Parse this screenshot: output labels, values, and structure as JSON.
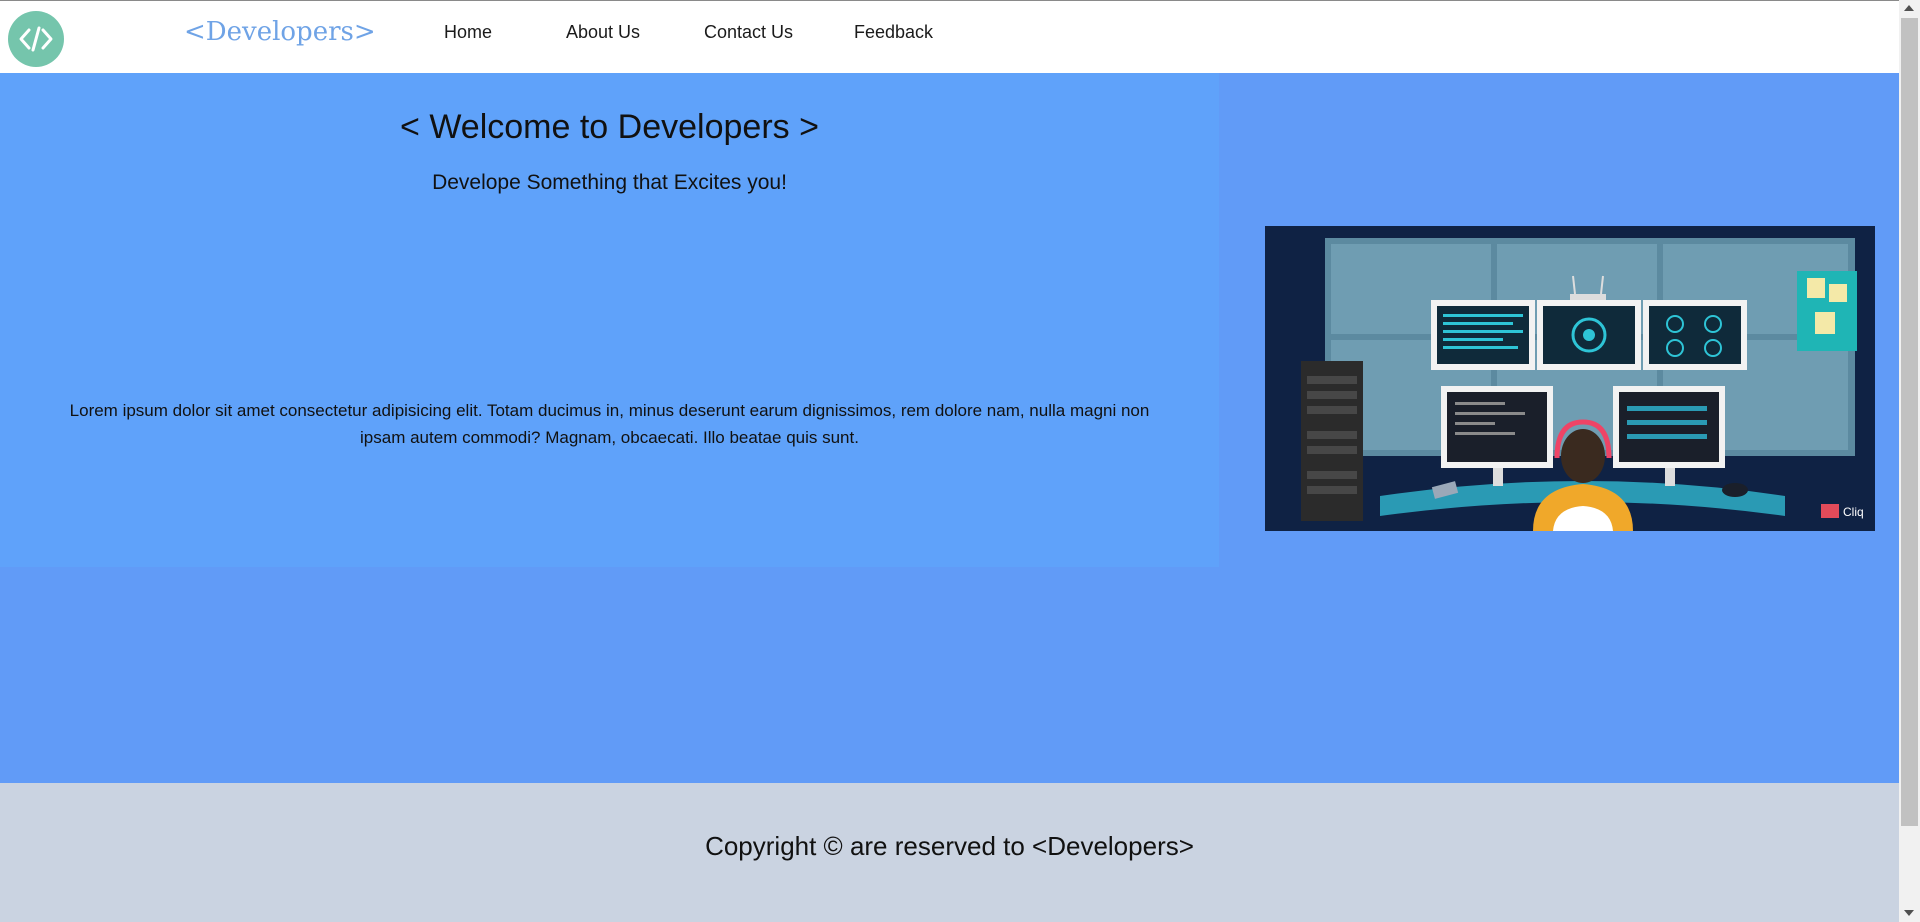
{
  "navbar": {
    "logo_icon": "code-brackets-icon",
    "brand": "<Developers>",
    "links": [
      "Home",
      "About Us",
      "Contact Us",
      "Feedback"
    ]
  },
  "hero": {
    "title": "< Welcome to Developers >",
    "subtitle": "Develope Something that Excites you!",
    "body": "Lorem ipsum dolor sit amet consectetur adipisicing elit. Totam ducimus in, minus deserunt earum dignissimos, rem dolore nam, nulla magni non ipsam autem commodi? Magnam, obcaecati. Illo beatae quis sunt.",
    "illustration_watermark": "Cliq"
  },
  "footer": {
    "text": "Copyright © are reserved to <Developers>"
  },
  "colors": {
    "navbar_bg": "#ffffff",
    "brand": "#6fa3e6",
    "logo_bg": "#75c5ac",
    "main_bg": "#619bf7",
    "hero_bg": "#5fa2fa",
    "footer_bg": "#cad3e1"
  }
}
